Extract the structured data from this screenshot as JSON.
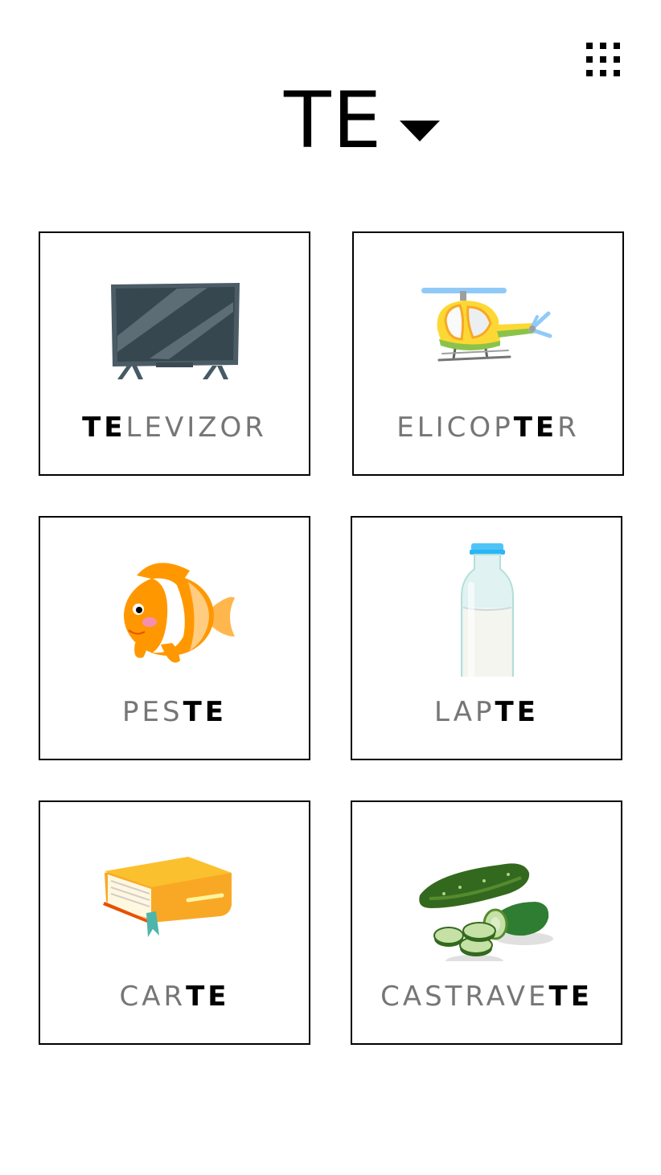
{
  "header": {
    "syllable": "TE",
    "dropdown_icon": "caret-down-icon",
    "menu_icon": "grid-menu-icon"
  },
  "colors": {
    "background": "#ffffff",
    "border": "#000000",
    "highlight_text": "#000000",
    "muted_text": "#767676"
  },
  "cards": [
    {
      "icon": "television-icon",
      "before": "",
      "highlight": "TE",
      "after": "LEVIZOR"
    },
    {
      "icon": "helicopter-icon",
      "before": "ELICOP",
      "highlight": "TE",
      "after": "R"
    },
    {
      "icon": "fish-icon",
      "before": "PES",
      "highlight": "TE",
      "after": ""
    },
    {
      "icon": "milk-bottle-icon",
      "before": "LAP",
      "highlight": "TE",
      "after": ""
    },
    {
      "icon": "book-icon",
      "before": "CAR",
      "highlight": "TE",
      "after": ""
    },
    {
      "icon": "cucumber-icon",
      "before": "CASTRAVE",
      "highlight": "TE",
      "after": ""
    }
  ]
}
